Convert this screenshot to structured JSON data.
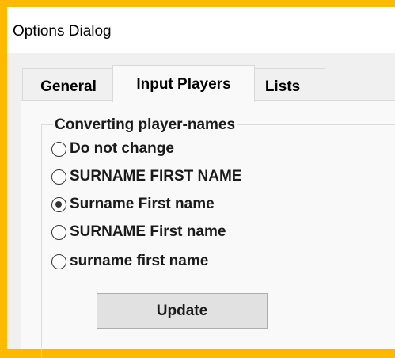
{
  "window": {
    "title": "Options Dialog"
  },
  "tabs": [
    {
      "label": "General",
      "selected": false
    },
    {
      "label": "Input Players",
      "selected": true
    },
    {
      "label": "Lists",
      "selected": false
    }
  ],
  "converting_group": {
    "title": "Converting player-names",
    "options": [
      {
        "label": "Do not change",
        "checked": false
      },
      {
        "label": "SURNAME FIRST NAME",
        "checked": false
      },
      {
        "label": "Surname First name",
        "checked": true
      },
      {
        "label": "SURNAME First name",
        "checked": false
      },
      {
        "label": "surname first name",
        "checked": false
      }
    ],
    "update_label": "Update"
  },
  "colors": {
    "background_accent": "#ffb900",
    "window_bg": "#f0f0f0",
    "panel_bg": "#f9f9f9",
    "button_bg": "#e1e1e1"
  }
}
